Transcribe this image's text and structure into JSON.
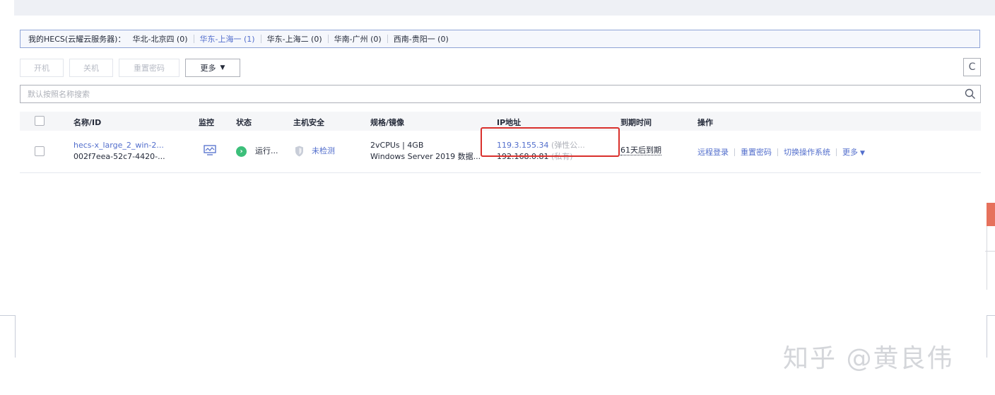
{
  "region_bar": {
    "lead": "我的HECS(云耀云服务器)：",
    "regions": [
      {
        "label": "华北-北京四 (0)",
        "active": false
      },
      {
        "label": "华东-上海一 (1)",
        "active": true
      },
      {
        "label": "华东-上海二 (0)",
        "active": false
      },
      {
        "label": "华南-广州 (0)",
        "active": false
      },
      {
        "label": "西南-贵阳一 (0)",
        "active": false
      }
    ]
  },
  "toolbar": {
    "start_label": "开机",
    "stop_label": "关机",
    "reset_password_label": "重置密码",
    "more_label": "更多",
    "refresh_glyph": "C"
  },
  "search": {
    "placeholder": "默认按照名称搜索"
  },
  "table": {
    "columns": [
      "名称/ID",
      "监控",
      "状态",
      "主机安全",
      "规格/镜像",
      "IP地址",
      "到期时间",
      "操作"
    ],
    "rows": [
      {
        "name": "hecs-x_large_2_win-2...",
        "id": "002f7eea-52c7-4420-...",
        "status": "运行...",
        "security": "未检测",
        "spec": "2vCPUs | 4GB",
        "image": "Windows Server 2019 数据...",
        "public_ip": "119.3.155.34",
        "public_ip_tag": "(弹性公...",
        "private_ip": "192.168.0.81",
        "private_ip_tag": "(私有)",
        "expiry": "61天后到期",
        "ops": [
          "远程登录",
          "重置密码",
          "切换操作系统",
          "更多"
        ]
      }
    ]
  },
  "watermark": "知乎 @黄良伟",
  "colors": {
    "link": "#526ecc",
    "running": "#3cbf7a",
    "highlight": "#d9302c"
  }
}
